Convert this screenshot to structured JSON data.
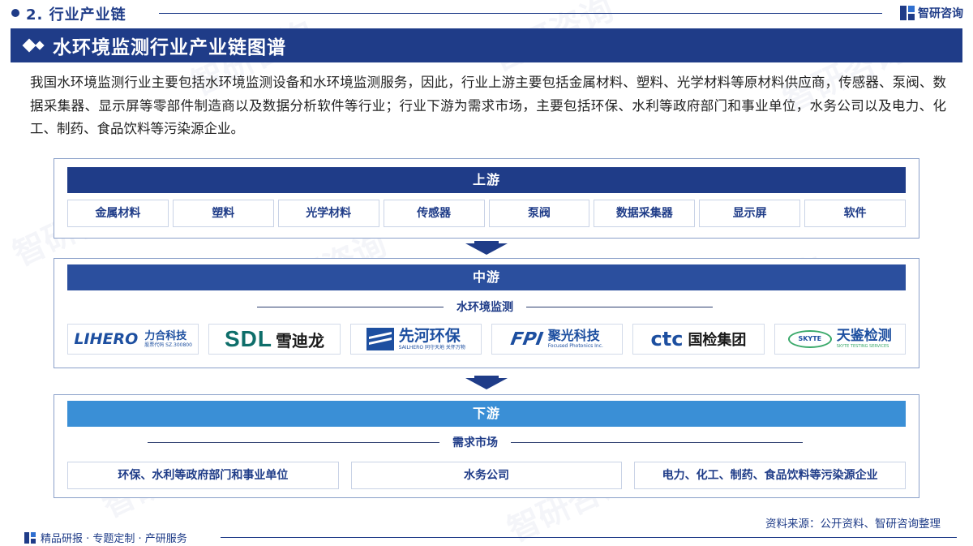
{
  "header": {
    "section": "2. 行业产业链",
    "brand": "智研咨询"
  },
  "title": "水环境监测行业产业链图谱",
  "intro": "我国水环境监测行业主要包括水环境监测设备和水环境监测服务，因此，行业上游主要包括金属材料、塑料、光学材料等原材料供应商，传感器、泵阀、数据采集器、显示屏等零部件制造商以及数据分析软件等行业；行业下游为需求市场，主要包括环保、水利等政府部门和事业单位，水务公司以及电力、化工、制药、食品饮料等污染源企业。",
  "upstream": {
    "label": "上游",
    "items": [
      "金属材料",
      "塑料",
      "光学材料",
      "传感器",
      "泵阀",
      "数据采集器",
      "显示屏",
      "软件"
    ]
  },
  "midstream": {
    "label": "中游",
    "sublabel": "水环境监测",
    "logos": {
      "lihero": {
        "en": "LIHERO",
        "zh": "力合科技",
        "code": "股票代码 SZ.300800"
      },
      "sdl": {
        "en": "SDL",
        "zh": "雪迪龙"
      },
      "sailhero": {
        "zh": "先河环保",
        "sub": "SAILHERO  同守天地 关怀万物"
      },
      "fpi": {
        "en": "FPI",
        "zh": "聚光科技",
        "sub": "Focused Photonics Inc."
      },
      "ctc": {
        "en": "ctc",
        "zh": "国检集团"
      },
      "skyte": {
        "en": "SKYTE",
        "zh": "天鉴检测",
        "sub": "SKYTE TESTING SERVICES"
      }
    }
  },
  "downstream": {
    "label": "下游",
    "sublabel": "需求市场",
    "items": [
      "环保、水利等政府部门和事业单位",
      "水务公司",
      "电力、化工、制药、食品饮料等污染源企业"
    ]
  },
  "source": "资料来源：公开资料、智研咨询整理",
  "footer": {
    "slogan": "精品研报 · 专题定制 · 产研服务"
  },
  "watermark": "智研咨询",
  "colors": {
    "primary": "#1f3c88",
    "midstream_band": "#2b4f9e",
    "downstream_band": "#3a8fd6"
  }
}
